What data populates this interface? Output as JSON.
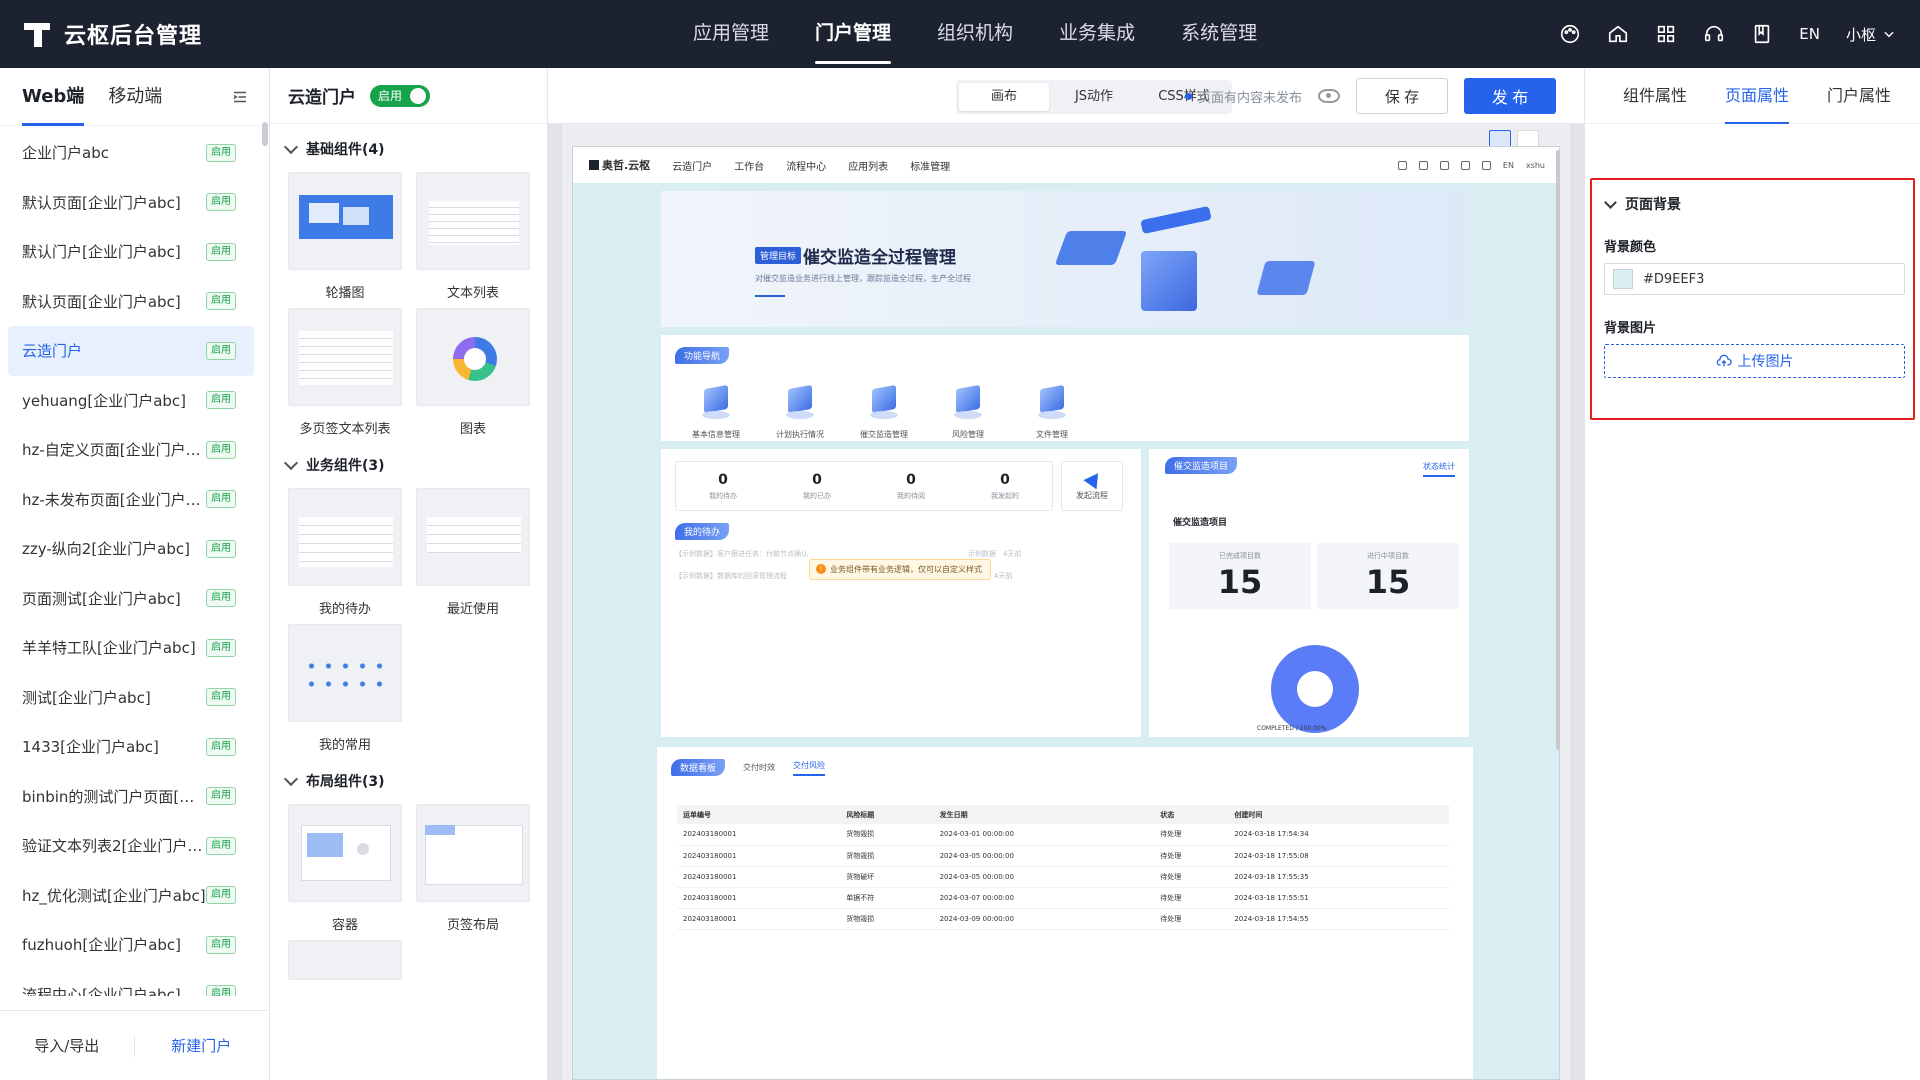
{
  "header": {
    "title": "云枢后台管理",
    "nav": [
      "应用管理",
      "门户管理",
      "组织机构",
      "业务集成",
      "系统管理"
    ],
    "active_nav": 1,
    "lang": "EN",
    "user": "小枢"
  },
  "left_panel": {
    "tabs": [
      "Web端",
      "移动端"
    ],
    "items": [
      {
        "name": "企业门户abc",
        "tag": "启用"
      },
      {
        "name": "默认页面[企业门户abc]",
        "tag": "启用"
      },
      {
        "name": "默认门户[企业门户abc]",
        "tag": "启用"
      },
      {
        "name": "默认页面[企业门户abc]",
        "tag": "启用"
      },
      {
        "name": "云造门户",
        "tag": "启用"
      },
      {
        "name": "yehuang[企业门户abc]",
        "tag": "启用"
      },
      {
        "name": "hz-自定义页面[企业门户ab...",
        "tag": "启用"
      },
      {
        "name": "hz-未发布页面[企业门户ab...",
        "tag": "启用"
      },
      {
        "name": "zzy-纵向2[企业门户abc]",
        "tag": "启用"
      },
      {
        "name": "页面测试[企业门户abc]",
        "tag": "启用"
      },
      {
        "name": "羊羊特工队[企业门户abc]",
        "tag": "启用"
      },
      {
        "name": "测试[企业门户abc]",
        "tag": "启用"
      },
      {
        "name": "1433[企业门户abc]",
        "tag": "启用"
      },
      {
        "name": "binbin的测试门户页面[企...",
        "tag": "启用"
      },
      {
        "name": "验证文本列表2[企业门户a...",
        "tag": "启用"
      },
      {
        "name": "hz_优化测试[企业门户abc]",
        "tag": "启用"
      },
      {
        "name": "fuzhuoh[企业门户abc]",
        "tag": "启用"
      },
      {
        "name": "流程中心[企业门户abc]",
        "tag": "启用"
      }
    ],
    "active_index": 4,
    "footer": {
      "import_export": "导入/导出",
      "new_portal": "新建门户"
    }
  },
  "component_panel": {
    "title": "云造门户",
    "status": "启用",
    "groups": [
      {
        "title": "基础组件(4)",
        "items": [
          "轮播图",
          "文本列表",
          "多页签文本列表",
          "图表"
        ]
      },
      {
        "title": "业务组件(3)",
        "items": [
          "我的待办",
          "最近使用",
          "我的常用"
        ]
      },
      {
        "title": "布局组件(3)",
        "items": [
          "容器",
          "页签布局"
        ]
      }
    ]
  },
  "toolbar": {
    "modes": [
      "画布",
      "JS动作",
      "CSS样式"
    ],
    "active_mode": 0,
    "unpublished": "页面有内容未发布",
    "save": "保 存",
    "publish": "发 布"
  },
  "preview": {
    "logo": "奥哲.云枢",
    "nav": [
      "云造门户",
      "工作台",
      "流程中心",
      "应用列表",
      "标准管理"
    ],
    "lang": "EN",
    "user": "xshu",
    "banner": {
      "badge": "管理目标",
      "title": "催交监造全过程管理",
      "subtitle": "对催交监造业务进行线上管理，跟踪监造全过程，生产全过程"
    },
    "func_nav": {
      "label": "功能导航",
      "items": [
        "基本信息管理",
        "计划执行情况",
        "催交监造管理",
        "风险管理",
        "文件管理"
      ]
    },
    "stats": [
      {
        "value": "0",
        "label": "我的待办"
      },
      {
        "value": "0",
        "label": "我的已办"
      },
      {
        "value": "0",
        "label": "我的待阅"
      },
      {
        "value": "0",
        "label": "我发起的"
      }
    ],
    "launch": "发起流程",
    "todo": {
      "label": "我的待办",
      "rows": [
        {
          "text": "【示例数据】客户跟进任务：付款节点确认",
          "meta": "示例数据　4天前"
        },
        {
          "text": "【示例数据】数据库的回滚管理流程",
          "meta": "示例数据　4天前"
        }
      ],
      "tip": "业务组件带有业务逻辑，仅可以自定义样式"
    },
    "supervision": {
      "label": "催交监造项目",
      "tab": "状态统计",
      "title": "催交监造项目",
      "completed_label": "已完成项目数",
      "completed_value": "15",
      "running_label": "进行中项目数",
      "running_value": "15",
      "donut_label": "COMPLETED / 100.00%"
    },
    "dashboard": {
      "label": "数据看板",
      "tabs": [
        "交付时效",
        "交付风险"
      ],
      "active_tab": 1,
      "columns": [
        "运单编号",
        "风险标题",
        "发生日期",
        "状态",
        "创建时间"
      ],
      "rows": [
        [
          "202403180001",
          "货物毁损",
          "2024-03-01 00:00:00",
          "待处理",
          "2024-03-18 17:54:34"
        ],
        [
          "202403180001",
          "货物毁损",
          "2024-03-05 00:00:00",
          "待处理",
          "2024-03-18 17:55:08"
        ],
        [
          "202403180001",
          "货物破坏",
          "2024-03-05 00:00:00",
          "待处理",
          "2024-03-18 17:55:35"
        ],
        [
          "202403180001",
          "单据不符",
          "2024-03-07 00:00:00",
          "待处理",
          "2024-03-18 17:55:51"
        ],
        [
          "202403180001",
          "货物毁损",
          "2024-03-09 00:00:00",
          "待处理",
          "2024-03-18 17:54:55"
        ]
      ]
    }
  },
  "right_panel": {
    "tabs": [
      "组件属性",
      "页面属性",
      "门户属性"
    ],
    "active_tab": 1,
    "section": "页面背景",
    "bg_color_label": "背景颜色",
    "bg_color": "#D9EEF3",
    "bg_image_label": "背景图片",
    "upload": "上传图片"
  },
  "colors": {
    "accent": "#2563eb",
    "topbar": "#1d2230",
    "page_bg": "#D9EEF3",
    "highlight_box": "#e41d1d"
  }
}
